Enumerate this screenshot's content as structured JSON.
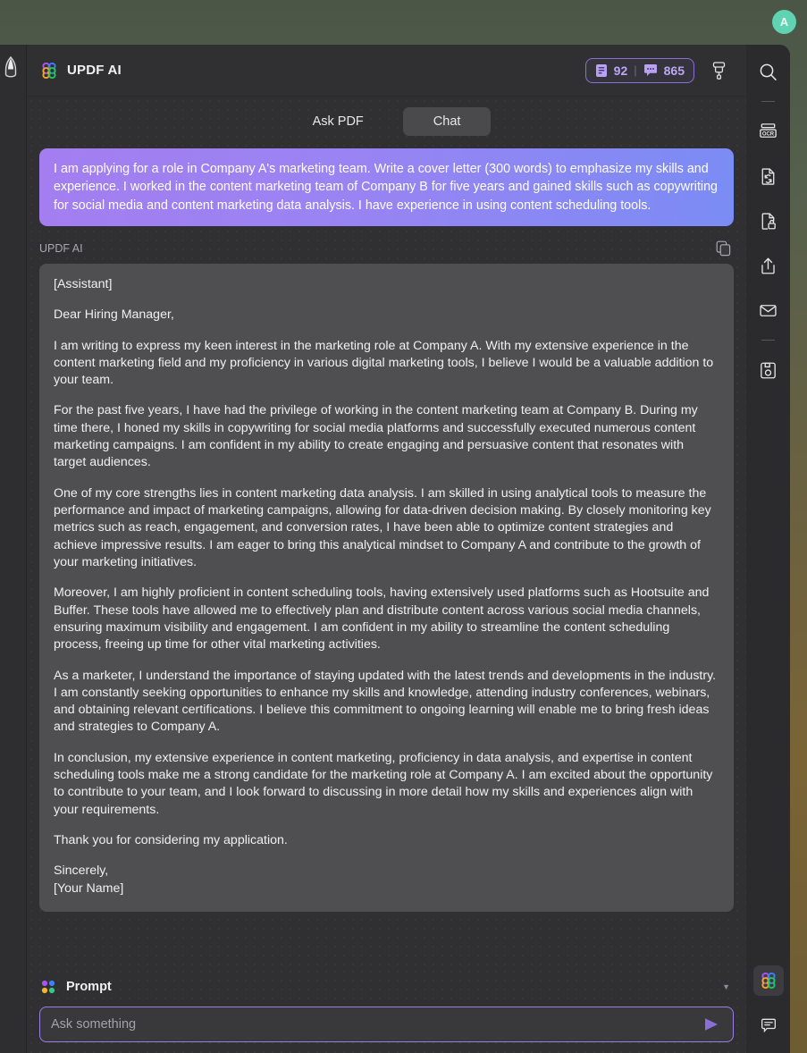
{
  "desktop": {
    "avatar_initial": "A"
  },
  "app": {
    "brand_name": "UPDF AI",
    "left_rail": {
      "pen_icon": "pen-nib-icon"
    },
    "header": {
      "credits": {
        "pages_icon": "document-icon",
        "pages_value": "92",
        "divider": "|",
        "chat_icon": "chat-bubble-icon",
        "chat_value": "865"
      },
      "brush_label": "brush-icon"
    },
    "tabs": [
      {
        "label": "Ask PDF",
        "active": false
      },
      {
        "label": "Chat",
        "active": true
      }
    ],
    "conversation": {
      "user_message": "I am applying for a role in Company A's marketing team. Write a cover letter (300 words) to emphasize my skills and experience. I worked in the content marketing team of Company B for five years and gained skills such as copywriting for social media and content marketing data analysis. I have experience in using content scheduling tools.",
      "assistant_label": "UPDF AI",
      "copy_label": "copy-icon",
      "assistant_paragraphs": [
        "[Assistant]",
        "Dear Hiring Manager,",
        "I am writing to express my keen interest in the marketing role at Company A. With my extensive experience in the content marketing field and my proficiency in various digital marketing tools, I believe I would be a valuable addition to your team.",
        "For the past five years, I have had the privilege of working in the content marketing team at Company B. During my time there, I honed my skills in copywriting for social media platforms and successfully executed numerous content marketing campaigns. I am confident in my ability to create engaging and persuasive content that resonates with target audiences.",
        "One of my core strengths lies in content marketing data analysis. I am skilled in using analytical tools to measure the performance and impact of marketing campaigns, allowing for data-driven decision making. By closely monitoring key metrics such as reach, engagement, and conversion rates, I have been able to optimize content strategies and achieve impressive results. I am eager to bring this analytical mindset to Company A and contribute to the growth of your marketing initiatives.",
        "Moreover, I am highly proficient in content scheduling tools, having extensively used platforms such as Hootsuite and Buffer. These tools have allowed me to effectively plan and distribute content across various social media channels, ensuring maximum visibility and engagement. I am confident in my ability to streamline the content scheduling process, freeing up time for other vital marketing activities.",
        "As a marketer, I understand the importance of staying updated with the latest trends and developments in the industry. I am constantly seeking opportunities to enhance my skills and knowledge, attending industry conferences, webinars, and obtaining relevant certifications. I believe this commitment to ongoing learning will enable me to bring fresh ideas and strategies to Company A.",
        "In conclusion, my extensive experience in content marketing, proficiency in data analysis, and expertise in content scheduling tools make me a strong candidate for the marketing role at Company A. I am excited about the opportunity to contribute to your team, and I look forward to discussing in more detail how my skills and experiences align with your requirements.",
        "Thank you for considering my application."
      ],
      "assistant_signature": "Sincerely,\n[Your Name]"
    },
    "prompt_footer": {
      "prompt_label": "Prompt",
      "prompt_dots_icon": "four-dots-icon",
      "chevron_icon": "chevron-down-icon",
      "input_placeholder": "Ask something",
      "input_value": "",
      "send_icon": "send-arrow-icon"
    },
    "right_rail": [
      {
        "name": "search-icon",
        "type": "tool"
      },
      {
        "name": "divider",
        "type": "divider"
      },
      {
        "name": "ocr-icon",
        "type": "tool"
      },
      {
        "name": "convert-document-icon",
        "type": "tool"
      },
      {
        "name": "protect-document-icon",
        "type": "tool"
      },
      {
        "name": "share-export-icon",
        "type": "tool"
      },
      {
        "name": "mail-icon",
        "type": "tool"
      },
      {
        "name": "divider",
        "type": "divider"
      },
      {
        "name": "save-icon",
        "type": "tool"
      }
    ],
    "right_rail_bottom": [
      {
        "name": "updf-ai-icon",
        "selected": true
      },
      {
        "name": "comment-icon",
        "selected": false
      }
    ]
  },
  "colors": {
    "accent_purple": "#9d7de8",
    "badge_text": "#bda6f2",
    "bubble_gradient_start": "#a47ef0",
    "bubble_gradient_end": "#7b8cf5",
    "assistant_bubble_bg": "#4f4f51",
    "avatar_bg": "#5fd3b2",
    "panel_bg": "#303033",
    "rail_bg": "#2b2b2d"
  }
}
